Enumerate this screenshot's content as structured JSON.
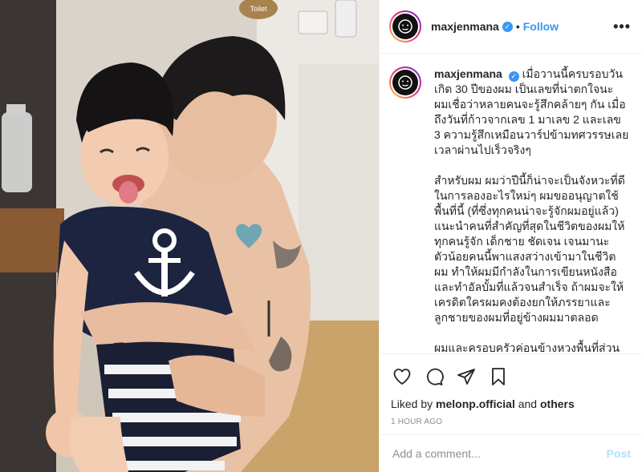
{
  "post": {
    "photo_alt": "Photo of a man kissing a smiling boy on the cheek",
    "toilet_sign": "Toilet",
    "author": {
      "username": "maxjenmana",
      "verified": true,
      "verified_icon": "verified-badge-icon"
    },
    "header": {
      "separator": "•",
      "follow_label": "Follow",
      "more_label": "•••"
    },
    "caption": {
      "username": "maxjenmana",
      "paragraphs": [
        "เมื่อวานนี้ครบรอบวันเกิด 30 ปีของผม เป็นเลขที่น่าตกใจนะ ผมเชื่อว่าหลายคนจะรู้สึกคล้ายๆ กัน เมื่อถึงวันที่ก้าวจากเลข 1 มาเลข 2 และเลข 3 ความรู้สึกเหมือนวาร์ปข้ามทศวรรษเลย เวลาผ่านไปเร็วจริงๆ",
        "สำหรับผม ผมว่าปีนี้ก็น่าจะเป็นจังหวะที่ดีในการลองอะไรใหม่ๆ ผมขออนุญาตใช้พื้นที่นี้ (ที่ซึ่งทุกคนน่าจะรู้จักผมอยู่แล้ว) แนะนำคนที่สำคัญที่สุดในชีวิตของผมให้ทุกคนรู้จัก เด็กชาย ชัดเจน เจนมานะ\nตัวน้อยคนนี้พาแสงสว่างเข้ามาในชีวิตผม ทำให้ผมมีกำลังในการเขียนหนังสือและทำอัลบั้มที่แล้วจนสำเร็จ ถ้าผมจะให้เครดิตใครผมคงต้องยกให้ภรรยาและลูกชายของผมที่อยู่ข้างผมมาตลอด",
        "ผมและครอบครัวค่อนข้างหวงพื้นที่ส่วนตัว โดยเฉพาะเรื่อง social ผมจะขีเรียสมาก"
      ]
    },
    "actions": {
      "like_icon": "heart-icon",
      "comment_icon": "comment-bubble-icon",
      "share_icon": "share-paper-plane-icon",
      "save_icon": "bookmark-icon"
    },
    "likes": {
      "prefix": "Liked by",
      "user": "melonp.official",
      "connector": "and",
      "others": "others"
    },
    "timestamp": "1 HOUR AGO",
    "comment": {
      "placeholder": "Add a comment...",
      "post_label": "Post"
    }
  },
  "colors": {
    "link_blue": "#3897f0",
    "post_disabled": "#b2dffc",
    "muted": "#8e8e8e",
    "text": "#262626",
    "story_ring": [
      "#f9ce34",
      "#ee2a7b",
      "#6228d7"
    ]
  }
}
